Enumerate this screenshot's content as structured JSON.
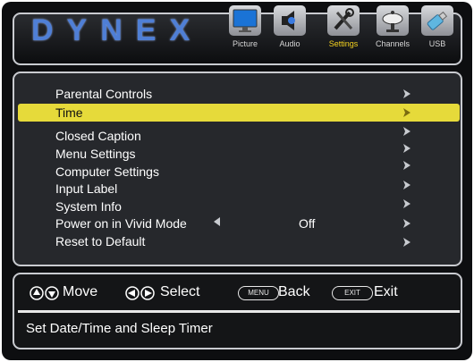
{
  "brand": {
    "logo": "DYNEX",
    "accent": "#4f7fd6"
  },
  "tabs": [
    {
      "label": "Picture",
      "icon": "tv-icon"
    },
    {
      "label": "Audio",
      "icon": "speaker-icon"
    },
    {
      "label": "Settings",
      "icon": "tools-icon",
      "active": true
    },
    {
      "label": "Channels",
      "icon": "satellite-dish-icon"
    },
    {
      "label": "USB",
      "icon": "usb-drive-icon"
    }
  ],
  "menu": {
    "items": [
      {
        "label": "Parental Controls"
      },
      {
        "label": "Time",
        "selected": true
      },
      {
        "label": "Closed Caption"
      },
      {
        "label": "Menu Settings"
      },
      {
        "label": "Computer Settings"
      },
      {
        "label": "Input Label"
      },
      {
        "label": "System Info"
      },
      {
        "label": "Power on in Vivid Mode",
        "value": "Off"
      },
      {
        "label": "Reset to Default"
      }
    ],
    "highlight_color": "#e6da3a"
  },
  "hints": {
    "move": "Move",
    "select": "Select",
    "menu_key": "MENU",
    "back": "Back",
    "exit_key": "EXIT",
    "exit": "Exit"
  },
  "description": "Set Date/Time and Sleep Timer"
}
